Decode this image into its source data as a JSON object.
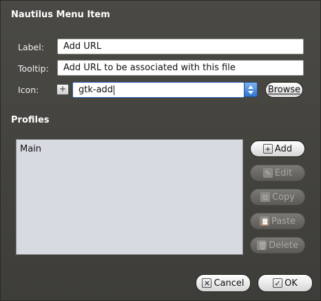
{
  "dialog": {
    "title": "Nautilus Menu Item"
  },
  "form": {
    "label_caption": "Label:",
    "label_value": "Add URL",
    "tooltip_caption": "Tooltip:",
    "tooltip_value": "Add URL to be associated with this file",
    "icon_caption": "Icon:",
    "icon_preview_glyph": "+",
    "icon_value": "gtk-add",
    "browse_label": "Browse"
  },
  "profiles": {
    "heading": "Profiles",
    "items": [
      "Main"
    ],
    "buttons": {
      "add": {
        "label": "Add",
        "icon": "+",
        "enabled": true
      },
      "edit": {
        "label": "Edit",
        "icon": "✎",
        "enabled": false
      },
      "copy": {
        "label": "Copy",
        "icon": "⧉",
        "enabled": false
      },
      "paste": {
        "label": "Paste",
        "icon": "📋",
        "enabled": false
      },
      "delete": {
        "label": "Delete",
        "icon": "🗑",
        "enabled": false
      }
    }
  },
  "footer": {
    "cancel_label": "Cancel",
    "cancel_icon": "✕",
    "ok_label": "OK",
    "ok_icon": "✓"
  }
}
